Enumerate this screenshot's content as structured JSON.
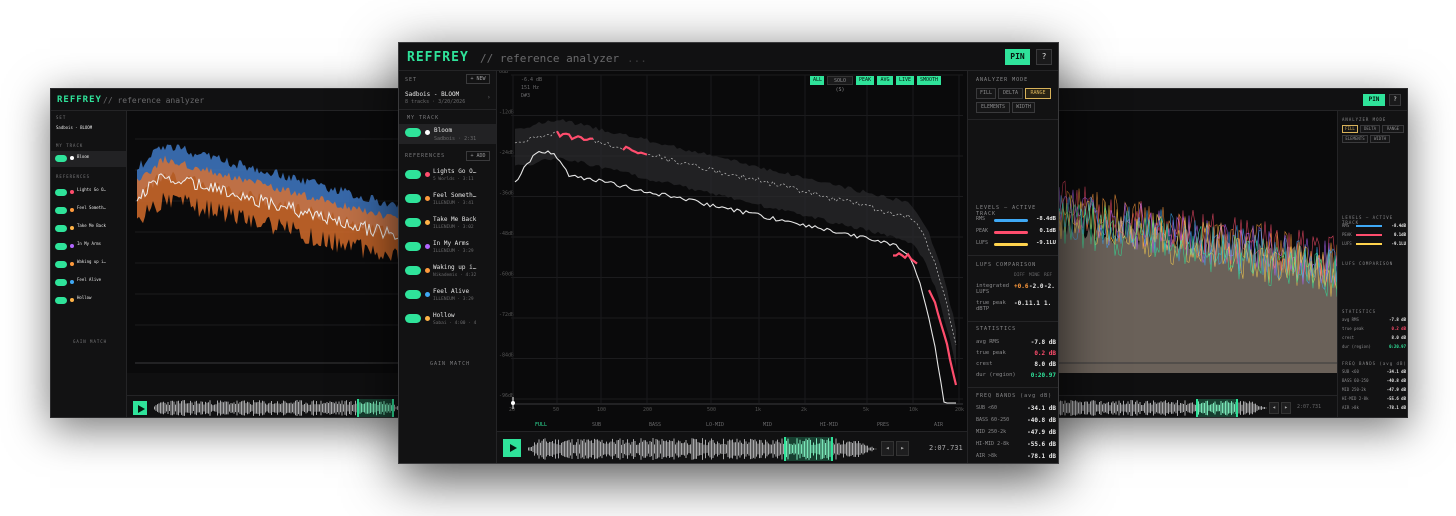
{
  "app": {
    "brand": "REFFREY",
    "subtitle": "// reference analyzer",
    "ellipsis": "...",
    "pin": "PIN",
    "help": "?"
  },
  "set": {
    "label": "SET",
    "new": "+ NEW",
    "name": "Sadbois - BLOOM",
    "meta": "8 tracks · 3/20/2026"
  },
  "my_track": {
    "label": "MY TRACK",
    "name": "Bloom",
    "meta": "Sadbois · 2:31",
    "dot": "#ffffff"
  },
  "references": {
    "label": "REFERENCES",
    "add": "+ ADD",
    "items": [
      {
        "name": "Lights Go O…",
        "meta": "5 Worlds · 3:11",
        "dot": "#ff4d6d"
      },
      {
        "name": "Feel Someth…",
        "meta": "ILLENIUM · 3:41",
        "dot": "#ff9a3c"
      },
      {
        "name": "Take Me Back",
        "meta": "ILLENIUM · 3:02",
        "dot": "#ffb347"
      },
      {
        "name": "In My Arms",
        "meta": "ILLENIUM · 3:29",
        "dot": "#b266ff"
      },
      {
        "name": "Waking up i…",
        "meta": "Nikademis · 4:32",
        "dot": "#ff9a3c"
      },
      {
        "name": "Feel Alive",
        "meta": "ILLENIUM · 3:29",
        "dot": "#3fa9f5"
      },
      {
        "name": "Hollow",
        "meta": "Sabai · 4:00 · 4",
        "dot": "#ffb347"
      }
    ],
    "gain_match": "GAIN MATCH"
  },
  "plot": {
    "readout": [
      "-6.4 dB",
      "151 Hz",
      "D#3"
    ],
    "chips": [
      "ALL",
      "SOLO (S)",
      "PEAK",
      "AVG",
      "LIVE",
      "SMOOTH"
    ],
    "chip_state": [
      true,
      false,
      true,
      true,
      true,
      true
    ],
    "y_ticks": [
      "0dB",
      "-12dB",
      "-24dB",
      "-36dB",
      "-48dB",
      "-60dB",
      "-72dB",
      "-84dB",
      "-96dB"
    ],
    "x_ticks": [
      "20",
      "50",
      "100",
      "200",
      "500",
      "1k",
      "2k",
      "5k",
      "10k",
      "20k"
    ],
    "bands": [
      "FULL",
      "SUB",
      "BASS",
      "LO-MID",
      "MID",
      "HI-MID",
      "PRES",
      "AIR"
    ],
    "time": "2:07.731"
  },
  "analyzer_mode": {
    "title": "ANALYZER MODE",
    "buttons": [
      "FILL",
      "DELTA",
      "RANGE",
      "ELEMENTS",
      "WIDTH"
    ],
    "active": "RANGE"
  },
  "levels": {
    "title": "LEVELS — ACTIVE TRACK",
    "rows": [
      {
        "k": "RMS",
        "v": "-8.4dB",
        "color": "#3fa9f5"
      },
      {
        "k": "PEAK",
        "v": "0.1dB",
        "color": "#ff4d6d"
      },
      {
        "k": "LUFS",
        "v": "-9.1LU",
        "color": "#ffd34d"
      }
    ]
  },
  "lufs": {
    "title": "LUFS COMPARISON",
    "headers": [
      "DIFF",
      "MINE",
      "REF"
    ],
    "rows": [
      {
        "k": "integrated LUFS",
        "diff": "+0.6",
        "mine": "-2.0",
        "ref": "-2."
      },
      {
        "k": "true peak dBTP",
        "diff": "-0.1",
        "mine": "1.1",
        "ref": "1."
      }
    ]
  },
  "stats": {
    "title": "STATISTICS",
    "rows": [
      {
        "k": "avg RMS",
        "v": "-7.8 dB",
        "color": "#e8e8e8"
      },
      {
        "k": "true peak",
        "v": "0.2 dB",
        "color": "#ff4d6d"
      },
      {
        "k": "crest",
        "v": "8.0 dB",
        "color": "#e8e8e8"
      },
      {
        "k": "dur (region)",
        "v": "0:20.97",
        "color": "#2fe39a"
      }
    ]
  },
  "freq": {
    "title": "FREQ BANDS (avg dB)",
    "rows": [
      {
        "k": "SUB <60",
        "v": "-34.1 dB"
      },
      {
        "k": "BASS 60-250",
        "v": "-40.8 dB"
      },
      {
        "k": "MID 250-2k",
        "v": "-47.9 dB"
      },
      {
        "k": "HI-MID 2-8k",
        "v": "-55.6 dB"
      },
      {
        "k": "AIR >8k",
        "v": "-78.1 dB"
      }
    ]
  },
  "colors": {
    "accent": "#2fe39a",
    "mine": "#ffffff",
    "ref": "#ff4d6d"
  }
}
